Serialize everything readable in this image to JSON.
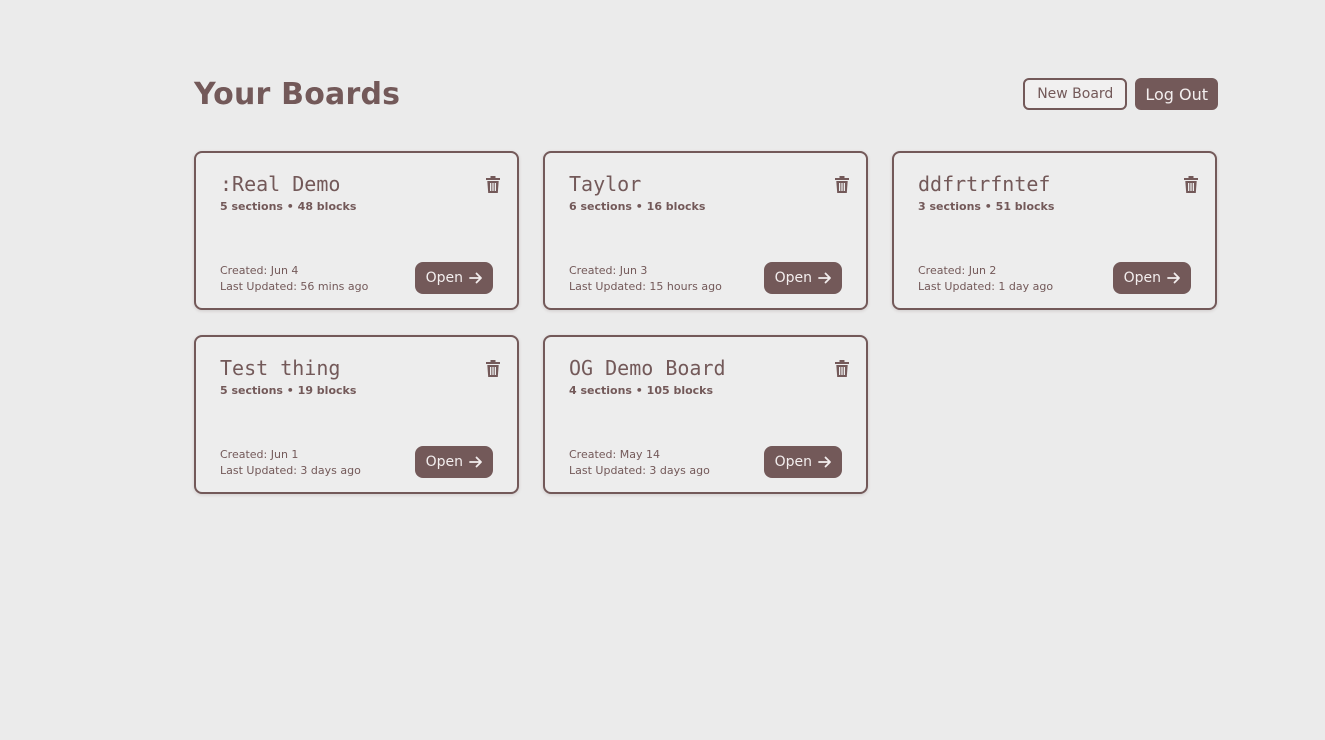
{
  "header": {
    "title": "Your Boards",
    "new_board_label": "New Board",
    "logout_label": "Log Out"
  },
  "boards": [
    {
      "title": ":Real Demo",
      "meta": "5 sections • 48 blocks",
      "created": "Created: Jun 4",
      "updated": "Last Updated: 56 mins ago",
      "open_label": "Open"
    },
    {
      "title": "Taylor",
      "meta": "6 sections • 16 blocks",
      "created": "Created: Jun 3",
      "updated": "Last Updated: 15 hours ago",
      "open_label": "Open"
    },
    {
      "title": "ddfrtrfntef",
      "meta": "3 sections • 51 blocks",
      "created": "Created: Jun 2",
      "updated": "Last Updated: 1 day ago",
      "open_label": "Open"
    },
    {
      "title": "Test thing",
      "meta": "5 sections • 19 blocks",
      "created": "Created: Jun 1",
      "updated": "Last Updated: 3 days ago",
      "open_label": "Open"
    },
    {
      "title": "OG Demo Board",
      "meta": "4 sections • 105 blocks",
      "created": "Created: May 14",
      "updated": "Last Updated: 3 days ago",
      "open_label": "Open"
    }
  ],
  "icons": {
    "delete": "trash-icon",
    "open": "arrow-right-icon"
  },
  "colors": {
    "accent": "#735959",
    "background": "#ebebeb",
    "button_text": "#f3eeee"
  }
}
